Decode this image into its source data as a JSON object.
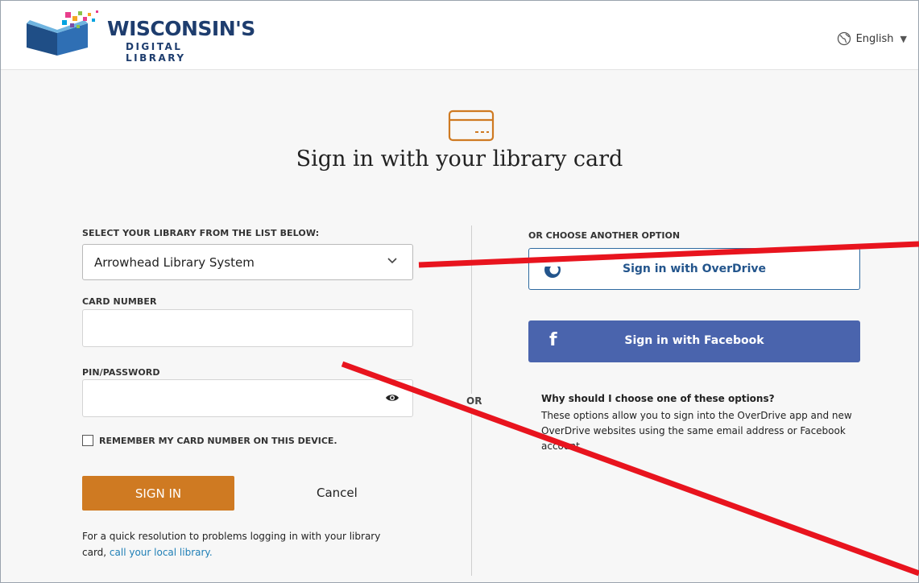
{
  "header": {
    "logo_title": "WISCONSIN'S",
    "logo_subtitle": "DIGITAL LIBRARY",
    "language": "English",
    "language_icon": "globe-icon"
  },
  "main": {
    "card_icon": "library-card-icon",
    "title": "Sign in with your library card",
    "library_label": "SELECT YOUR LIBRARY FROM THE LIST BELOW:",
    "library_selected": "Arrowhead Library System",
    "card_number_label": "CARD NUMBER",
    "card_number_value": "",
    "pin_label": "PIN/PASSWORD",
    "pin_value": "",
    "remember_label": "REMEMBER MY CARD NUMBER ON THIS DEVICE.",
    "signin_button": "SIGN IN",
    "cancel": "Cancel",
    "help_text": "For a quick resolution to problems logging in with your library card, ",
    "help_link": "call your local library."
  },
  "divider_or": "OR",
  "options": {
    "label": "OR CHOOSE ANOTHER OPTION",
    "overdrive_button": "Sign in with OverDrive",
    "facebook_button": "Sign in with Facebook",
    "facebook_glyph": "f",
    "why_title": "Why should I choose one of these options?",
    "why_body": "These options allow you to sign into the OverDrive app and new OverDrive websites using the same email address or Facebook account."
  },
  "colors": {
    "accent_orange": "#cf7a22",
    "facebook_blue": "#4a64ad",
    "overdrive_blue": "#23558c",
    "annotation_red": "#e8141e"
  }
}
